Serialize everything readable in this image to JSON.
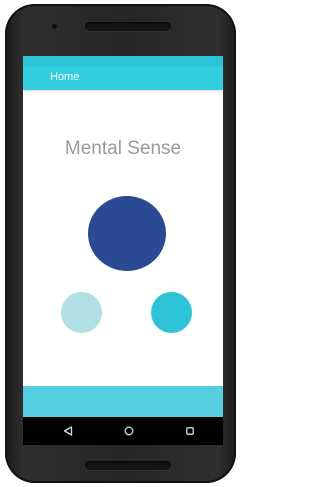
{
  "app_bar": {
    "title": "Home"
  },
  "main": {
    "headline": "Mental Sense",
    "circles": [
      {
        "name": "large-circle",
        "color": "#2a4a94"
      },
      {
        "name": "left-circle",
        "color": "#b0e0e4"
      },
      {
        "name": "right-circle",
        "color": "#2ec4d8"
      }
    ]
  },
  "nav_bar": {
    "buttons": [
      {
        "name": "back-icon"
      },
      {
        "name": "home-icon"
      },
      {
        "name": "recents-icon"
      }
    ]
  },
  "colors": {
    "accent": "#33cde0",
    "status_bar": "#2ec4d8",
    "bottom_bar": "#55cfe0",
    "headline_text": "#9a9a9a",
    "phone_frame": "#262626"
  }
}
